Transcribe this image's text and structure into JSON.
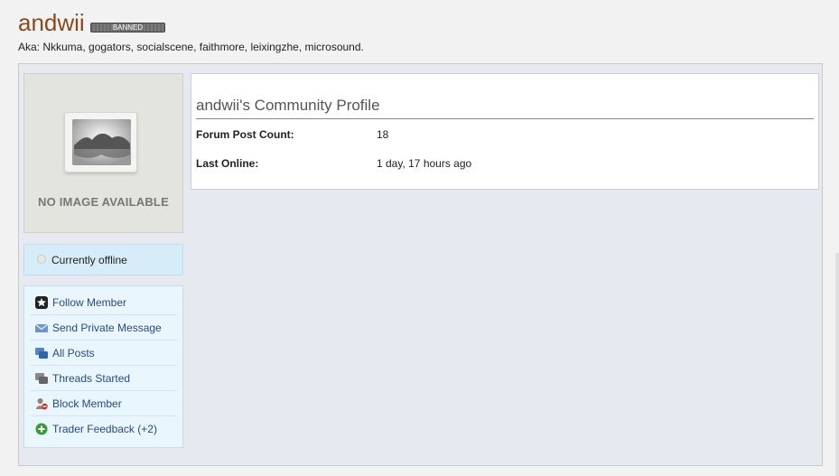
{
  "header": {
    "username": "andwii",
    "badge": "BANNED",
    "aka": "Aka: Nkkuma, gogators, socialscene, faithmore, leixingzhe, microsound."
  },
  "sidebar": {
    "avatar_text": "NO IMAGE AVAILABLE",
    "status": "Currently offline",
    "actions": [
      {
        "label": "Follow Member",
        "icon": "star-icon"
      },
      {
        "label": "Send Private Message",
        "icon": "envelope-icon"
      },
      {
        "label": "All Posts",
        "icon": "posts-icon"
      },
      {
        "label": "Threads Started",
        "icon": "threads-icon"
      },
      {
        "label": "Block Member",
        "icon": "block-user-icon"
      },
      {
        "label": "Trader Feedback (+2)",
        "icon": "plus-circle-icon"
      }
    ]
  },
  "profile": {
    "title": "andwii's Community Profile",
    "rows": [
      {
        "label": "Forum Post Count:",
        "value": "18"
      },
      {
        "label": "Last Online:",
        "value": "1 day, 17 hours ago"
      }
    ]
  },
  "colors": {
    "username": "#8b4a1c",
    "link": "#2a4a7a",
    "status_bg": "#d7ecf9",
    "actions_bg": "#eaf6fd",
    "panel_bg": "#e6e9ef"
  }
}
